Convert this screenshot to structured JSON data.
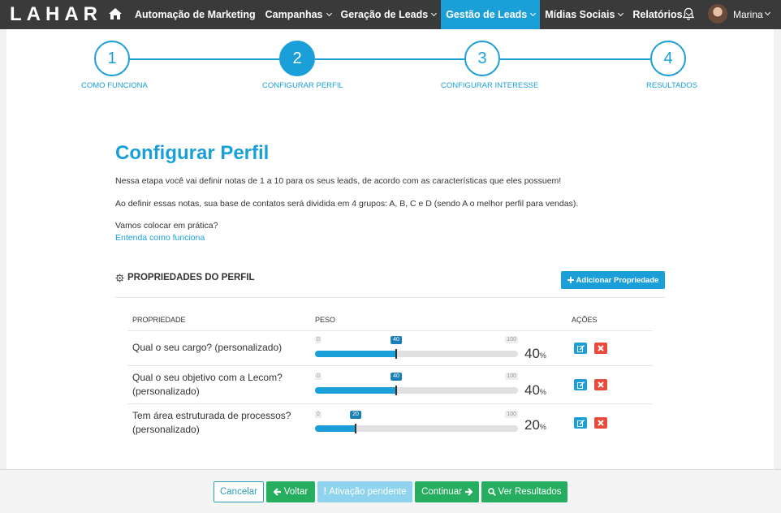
{
  "brand": {
    "logo_text": "LAHAR"
  },
  "nav": {
    "items": [
      {
        "label": "Automação de Marketing",
        "caret": false,
        "active": false
      },
      {
        "label": "Campanhas",
        "caret": true,
        "active": false
      },
      {
        "label": "Geração de Leads",
        "caret": true,
        "active": false
      },
      {
        "label": "Gestão de Leads",
        "caret": true,
        "active": true
      },
      {
        "label": "Mídias Sociais",
        "caret": true,
        "active": false
      },
      {
        "label": "Relatórios",
        "caret": true,
        "active": false
      }
    ],
    "user_name": "Marina"
  },
  "steps": [
    {
      "number": "1",
      "label": "COMO FUNCIONA",
      "active": false
    },
    {
      "number": "2",
      "label": "CONFIGURAR PERFIL",
      "active": true
    },
    {
      "number": "3",
      "label": "CONFIGURAR INTERESSE",
      "active": false
    },
    {
      "number": "4",
      "label": "RESULTADOS",
      "active": false
    }
  ],
  "content": {
    "title": "Configurar Perfil",
    "para1": "Nessa etapa você vai definir notas de 1 a 10 para os seus leads, de acordo com as características que eles possuem!",
    "para2": "Ao definir essas notas, sua base de contatos será dividida em 4 grupos: A, B, C e D (sendo A o melhor perfil para vendas).",
    "para3": "Vamos colocar em prática?",
    "link": "Entenda como funciona"
  },
  "section": {
    "title": "PROPRIEDADES DO PERFIL",
    "add_button": "Adicionar Propriedade"
  },
  "table": {
    "headers": {
      "property": "PROPRIEDADE",
      "weight": "PESO",
      "actions": "AÇÕES"
    },
    "slider_min": "0",
    "slider_max": "100",
    "rows": [
      {
        "line1": "Qual o seu cargo? (personalizado)",
        "line2": "",
        "value": 40,
        "value_label": "40",
        "pct": "40",
        "pct_unit": "%"
      },
      {
        "line1": "Qual o seu objetivo com a Lecom?",
        "line2": "(personalizado)",
        "value": 40,
        "value_label": "40",
        "pct": "40",
        "pct_unit": "%"
      },
      {
        "line1": "Tem área estruturada de processos?",
        "line2": "(personalizado)",
        "value": 20,
        "value_label": "20",
        "pct": "20",
        "pct_unit": "%"
      }
    ]
  },
  "footer": {
    "cancel": "Cancelar",
    "back": "Voltar",
    "pending": "Ativação pendente",
    "continue": "Continuar",
    "results": "Ver Resultados"
  },
  "colors": {
    "primary": "#1a9fd9",
    "nav_bg": "#3a3a3a",
    "success": "#26ae60",
    "danger": "#e74c3c"
  }
}
